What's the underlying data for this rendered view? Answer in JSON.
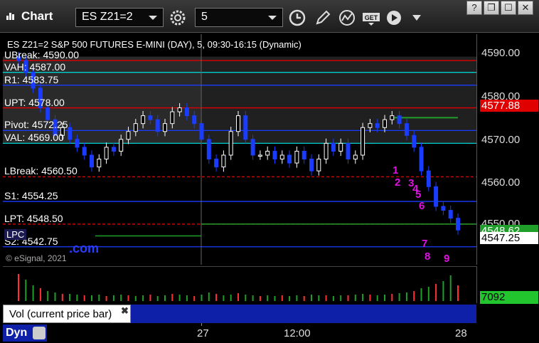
{
  "window": {
    "title": "Chart",
    "symbol_value": "ES Z21=2",
    "interval_value": "5",
    "controls": [
      "?",
      "❐",
      "☐",
      "✕"
    ]
  },
  "toolbar": {
    "icons": [
      "settings-icon",
      "clock-icon",
      "pencil-icon",
      "studies-icon",
      "get-icon",
      "play-icon",
      "more-icon"
    ]
  },
  "chart": {
    "caption": "ES Z21=2  S&P 500 FUTURES E-MINI (DAY), 5, 09:30-16:15 (Dynamic)",
    "copyright": "© eSignal, 2021",
    "dot_com": ".com",
    "lpc": "LPC",
    "levels": [
      {
        "key": "ubreak",
        "label": "UBreak: 4590.00",
        "price": 4590.0,
        "color": "#e00000"
      },
      {
        "key": "vah",
        "label": "VAH: 4587.00",
        "price": 4587.0,
        "color": "#00d0d0"
      },
      {
        "key": "r1",
        "label": "R1: 4583.75",
        "price": 4583.75,
        "color": "#1a3cff"
      },
      {
        "key": "upt",
        "label": "UPT: 4578.00",
        "price": 4578.0,
        "color": "#e00000"
      },
      {
        "key": "pivot",
        "label": "Pivot: 4572.25",
        "price": 4572.25,
        "color": "#1a3cff"
      },
      {
        "key": "val",
        "label": "VAL: 4569.00",
        "price": 4569.0,
        "color": "#00d0d0"
      },
      {
        "key": "lbreak",
        "label": "LBreak: 4560.50",
        "price": 4560.5,
        "color": "#e00000"
      },
      {
        "key": "s1",
        "label": "S1: 4554.25",
        "price": 4554.25,
        "color": "#1a3cff"
      },
      {
        "key": "lpt",
        "label": "LPT: 4548.50",
        "price": 4548.5,
        "color": "#e00000"
      },
      {
        "key": "s2",
        "label": "S2: 4542.75",
        "price": 4542.75,
        "color": "#1a3cff"
      }
    ],
    "markers": [
      "1",
      "2",
      "3",
      "4",
      "5",
      "6",
      "7",
      "8",
      "9"
    ]
  },
  "price_axis": {
    "ticks": [
      "4590.00",
      "4580.00",
      "4570.00",
      "4560.00",
      "4550.00"
    ],
    "badge_upt": "4577.88",
    "badge_green": "4548.62",
    "badge_last": "4547.25",
    "colors": {
      "upt": "#e00000",
      "green": "#1f9e2a",
      "last": "#ffffff"
    }
  },
  "volume": {
    "legend": "Vol (current price bar)",
    "close": "✖",
    "badge": "7092"
  },
  "time_axis": {
    "dyn": "Dyn",
    "labels": [
      "27",
      "12:00",
      "28"
    ]
  },
  "chart_data": {
    "type": "candlestick",
    "title": "ES Z21=2  S&P 500 FUTURES E-MINI (DAY), 5, 09:30-16:15 (Dynamic)",
    "ylim": [
      4540,
      4592
    ],
    "x_ticks": [
      "27",
      "12:00",
      "28"
    ],
    "y_ticks": [
      4550,
      4560,
      4570,
      4580,
      4590
    ],
    "grid": false,
    "last_price": 4547.25,
    "closes": [
      4590,
      4587,
      4583,
      4578,
      4575,
      4571,
      4573,
      4570,
      4568,
      4566,
      4563,
      4565,
      4568,
      4567,
      4570,
      4572,
      4574,
      4576,
      4575,
      4572,
      4574,
      4577,
      4578,
      4576,
      4574,
      4570,
      4565,
      4563,
      4566,
      4572,
      4576,
      4570,
      4566,
      4566,
      4567,
      4565,
      4566,
      4564,
      4567,
      4565,
      4562,
      4565,
      4569,
      4567,
      4569,
      4565,
      4566,
      4573,
      4574,
      4573,
      4575,
      4576,
      4574,
      4571,
      4568,
      4562,
      4558,
      4553,
      4552,
      4550,
      4547
    ]
  }
}
